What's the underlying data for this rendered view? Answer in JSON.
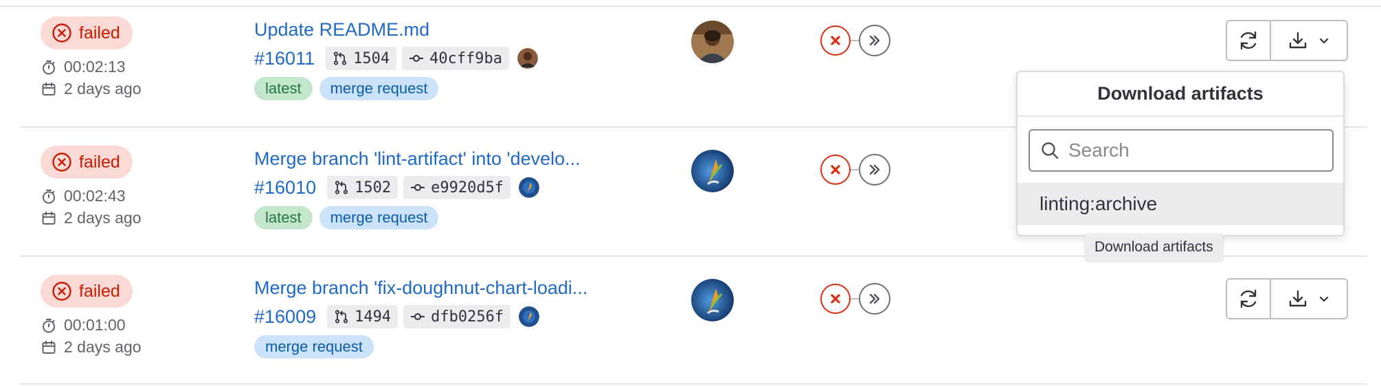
{
  "pipelines": [
    {
      "status": "failed",
      "duration": "00:02:13",
      "finished": "2 days ago",
      "title": "Update README.md",
      "id": "#16011",
      "mr": "1504",
      "commit": "40cff9ba",
      "tags": [
        "latest",
        "merge request"
      ]
    },
    {
      "status": "failed",
      "duration": "00:02:43",
      "finished": "2 days ago",
      "title": "Merge branch 'lint-artifact' into 'develo...",
      "id": "#16010",
      "mr": "1502",
      "commit": "e9920d5f",
      "tags": [
        "latest",
        "merge request"
      ]
    },
    {
      "status": "failed",
      "duration": "00:01:00",
      "finished": "2 days ago",
      "title": "Merge branch 'fix-doughnut-chart-loadi...",
      "id": "#16009",
      "mr": "1494",
      "commit": "dfb0256f",
      "tags": [
        "merge request"
      ]
    }
  ],
  "dropdown": {
    "title": "Download artifacts",
    "search_placeholder": "Search",
    "items": [
      "linting:archive"
    ]
  },
  "tooltip": "Download artifacts",
  "colors": {
    "failed_bg": "#fbd9d6",
    "failed_text": "#c91c00",
    "link": "#1f69c7",
    "tag_latest_bg": "#c3e6cd",
    "tag_mr_bg": "#cbe2f9"
  }
}
